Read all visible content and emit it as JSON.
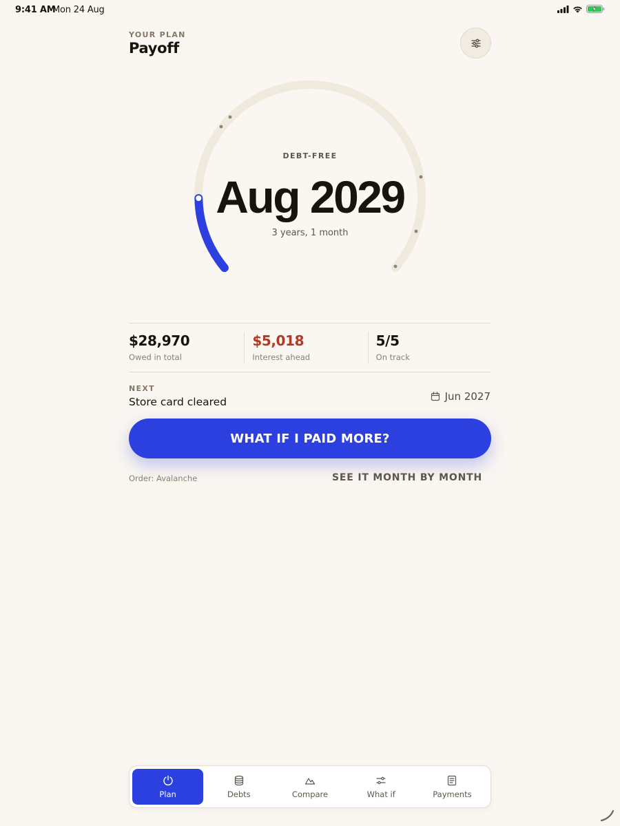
{
  "status_bar": {
    "time": "9:41 AM",
    "date": "Mon 24 Aug"
  },
  "header": {
    "eyebrow": "YOUR PLAN",
    "title": "Payoff"
  },
  "gauge": {
    "label": "DEBT-FREE",
    "date": "Aug 2029",
    "subtitle": "3 years, 1 month",
    "accent_color": "#2c40e0"
  },
  "stats": [
    {
      "value": "$28,970",
      "label": "Owed in total"
    },
    {
      "value": "$5,018",
      "label": "Interest ahead",
      "color": "#b03a23"
    },
    {
      "value": "5/5",
      "label": "On track"
    }
  ],
  "next": {
    "eyebrow": "NEXT",
    "title": "Store card cleared",
    "date": "Jun 2027"
  },
  "cta": {
    "label": "WHAT IF I PAID MORE?"
  },
  "footer": {
    "order": "Order: Avalanche",
    "link": "SEE IT MONTH BY MONTH"
  },
  "tabs": [
    {
      "label": "Plan",
      "icon": "power-icon",
      "active": true
    },
    {
      "label": "Debts",
      "icon": "database-icon",
      "active": false
    },
    {
      "label": "Compare",
      "icon": "mountain-icon",
      "active": false
    },
    {
      "label": "What if",
      "icon": "sliders-icon",
      "active": false
    },
    {
      "label": "Payments",
      "icon": "document-icon",
      "active": false
    }
  ]
}
